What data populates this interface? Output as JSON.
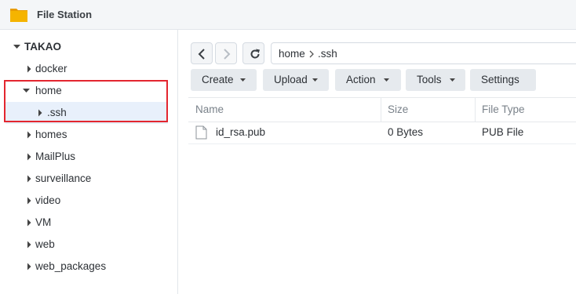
{
  "app": {
    "title": "File Station",
    "icon": "folder-icon",
    "accent_color": "#f5b400"
  },
  "sidebar": {
    "root_label": "TAKAO",
    "items": [
      {
        "label": "docker",
        "expanded": false
      },
      {
        "label": "home",
        "expanded": true
      },
      {
        "label": ".ssh",
        "expanded": false,
        "selected": true,
        "child_of": "home"
      },
      {
        "label": "homes",
        "expanded": false
      },
      {
        "label": "MailPlus",
        "expanded": false
      },
      {
        "label": "surveillance",
        "expanded": false
      },
      {
        "label": "video",
        "expanded": false
      },
      {
        "label": "VM",
        "expanded": false
      },
      {
        "label": "web",
        "expanded": false
      },
      {
        "label": "web_packages",
        "expanded": false
      }
    ],
    "highlight_color": "#e3262f",
    "selected_color": "#e8f0fb"
  },
  "navigation": {
    "back_icon": "chevron-left-icon",
    "forward_icon": "chevron-right-icon",
    "refresh_icon": "refresh-icon",
    "path": [
      "home",
      ".ssh"
    ]
  },
  "toolbar": {
    "create": "Create",
    "upload": "Upload",
    "action": "Action",
    "tools": "Tools",
    "settings": "Settings"
  },
  "file_list": {
    "columns": [
      "Name",
      "Size",
      "File Type"
    ],
    "rows": [
      {
        "name": "id_rsa.pub",
        "size": "0 Bytes",
        "type": "PUB File",
        "icon": "file-icon"
      }
    ]
  }
}
